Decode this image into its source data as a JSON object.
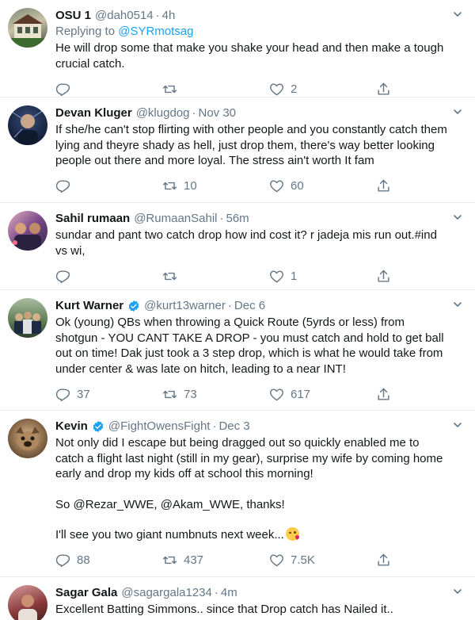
{
  "tweets": [
    {
      "name": "OSU 1",
      "handle": "@dah0514",
      "time": "4h",
      "verified": false,
      "replying_prefix": "Replying to ",
      "replying_to": "@SYRmotsag",
      "text_lines": [
        "He will drop some that make you shake your head and then make a tough crucial catch."
      ],
      "replies": "",
      "retweets": "",
      "likes": "2",
      "avatar_colors": [
        "#6b7b6a",
        "#c9c1a8",
        "#3b4a3a"
      ]
    },
    {
      "name": "Devan Kluger",
      "handle": "@klugdog",
      "time": "Nov 30",
      "verified": false,
      "text_lines": [
        "If she/he can't stop flirting with other people and you constantly catch them lying and theyre shady as hell, just drop them, there's way better looking people out there and more loyal. The stress ain't worth It fam"
      ],
      "replies": "",
      "retweets": "10",
      "likes": "60",
      "avatar_colors": [
        "#1b2a48",
        "#3a4e7a",
        "#0c1424"
      ]
    },
    {
      "name": "Sahil rumaan",
      "handle": "@RumaanSahil",
      "time": "56m",
      "verified": false,
      "text_lines": [
        "sundar and pant two catch drop how ind cost it? r jadeja mis run out.#ind vs wi,"
      ],
      "replies": "",
      "retweets": "",
      "likes": "1",
      "avatar_colors": [
        "#7a4a8a",
        "#e6b0c0",
        "#3a2a50"
      ]
    },
    {
      "name": "Kurt Warner",
      "handle": "@kurt13warner",
      "time": "Dec 6",
      "verified": true,
      "text_lines": [
        "Ok (young) QBs when throwing a Quick Route (5yrds or less) from shotgun - YOU CANT TAKE A DROP - you must catch and hold to get ball out on time! Dak just took a 3 step drop, which is what he would take from under center & was late on hitch, leading to a near INT!"
      ],
      "replies": "37",
      "retweets": "73",
      "likes": "617",
      "avatar_colors": [
        "#5d7a52",
        "#a9bda0",
        "#2e3d2a"
      ]
    },
    {
      "name": "Kevin",
      "handle": "@FightOwensFight",
      "time": "Dec 3",
      "verified": true,
      "text_lines": [
        "Not only did I escape but being dragged out so quickly enabled me to catch a flight last night (still in my gear), surprise my wife by coming home early and drop my kids off at school this morning!",
        "",
        "So @Rezar_WWE, @Akam_WWE, thanks!",
        "",
        "I'll see you two giant numbnuts next week..."
      ],
      "replies": "88",
      "retweets": "437",
      "likes": "7.5K",
      "avatar_colors": [
        "#8a6a4a",
        "#d9b48a",
        "#3a2a1a"
      ]
    },
    {
      "name": "Sagar Gala",
      "handle": "@sagargala1234",
      "time": "4m",
      "verified": false,
      "text_lines": [
        "Excellent Batting Simmons.. since that Drop catch has Nailed it.."
      ],
      "replies": "",
      "retweets": "",
      "likes": "",
      "avatar_colors": [
        "#8a3a3a",
        "#d8a0a0",
        "#401a1a"
      ]
    }
  ],
  "icons": {
    "reply": "reply-icon",
    "retweet": "retweet-icon",
    "like": "heart-icon",
    "share": "share-icon",
    "caret": "chevron-down-icon",
    "verified": "verified-badge-icon"
  },
  "colors": {
    "text": "#14171a",
    "secondary": "#657786",
    "link": "#1da1f2",
    "divider": "#e6ecf0"
  }
}
